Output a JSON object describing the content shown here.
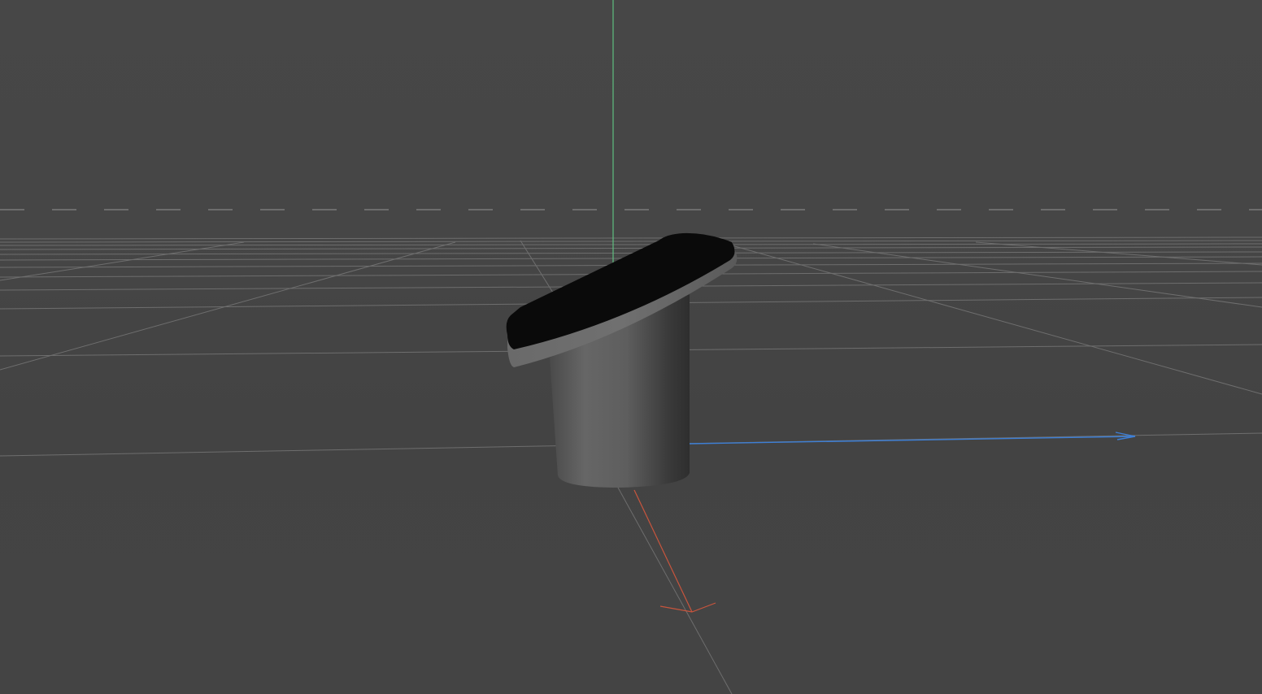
{
  "viewport": {
    "background": "#444444",
    "grid_color": "#6e6e6e",
    "horizon_color": "#7a7a7a",
    "axes": {
      "x_color": "#c8553d",
      "y_color": "#5fbf7f",
      "z_color": "#3d7fd6"
    },
    "object": {
      "type": "cylinder with tilted cap",
      "body_color": "#6a6a6a",
      "cap_top_color": "#0a0a0a",
      "cap_rim_color": "#6e6e6e"
    }
  }
}
